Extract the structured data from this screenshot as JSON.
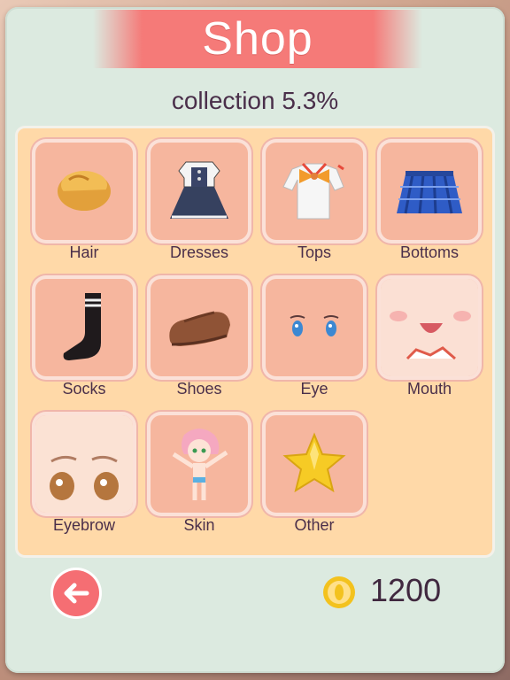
{
  "header": {
    "title": "Shop",
    "collection": "collection 5.3%"
  },
  "categories": [
    {
      "label": "Hair",
      "icon": "hair-icon"
    },
    {
      "label": "Dresses",
      "icon": "dress-icon"
    },
    {
      "label": "Tops",
      "icon": "top-icon"
    },
    {
      "label": "Bottoms",
      "icon": "skirt-icon"
    },
    {
      "label": "Socks",
      "icon": "sock-icon"
    },
    {
      "label": "Shoes",
      "icon": "shoe-icon"
    },
    {
      "label": "Eye",
      "icon": "eyes-icon"
    },
    {
      "label": "Mouth",
      "icon": "mouth-icon"
    },
    {
      "label": "Eyebrow",
      "icon": "eyebrow-icon"
    },
    {
      "label": "Skin",
      "icon": "skin-icon"
    },
    {
      "label": "Other",
      "icon": "star-icon"
    }
  ],
  "footer": {
    "back_icon": "back-arrow-icon",
    "coin_icon": "coin-icon",
    "coins": "1200"
  },
  "colors": {
    "title_bar": "#f57a78",
    "panel": "#dceae0",
    "grid_bg": "#ffd9a8",
    "tile": "#f6b69e",
    "text": "#4a2f4a",
    "back_button": "#f56e73",
    "coin": "#f3c21e"
  }
}
